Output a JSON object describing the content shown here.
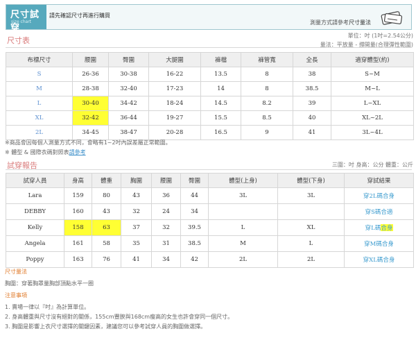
{
  "header": {
    "title": "尺寸試穿",
    "subtitle": "size chart",
    "tagline": "請先確認尺寸再進行購買",
    "right_text": "測量方式請參考",
    "right_strong": "尺寸量法"
  },
  "size_table": {
    "section_title": "尺寸表",
    "unit_note": "單位：吋 (1吋=2.54公分)",
    "method_note": "量法：平放量 - 撐開量(合理彈性範圍)",
    "columns": [
      "布標尺寸",
      "腰圍",
      "臀圍",
      "大腿圍",
      "褲檔",
      "褲管寬",
      "全長",
      "適穿體型(約)"
    ],
    "rows": [
      [
        "S",
        "26-36",
        "30-38",
        "16-22",
        "13.5",
        "8",
        "38",
        "S~M"
      ],
      [
        "M",
        "28-38",
        "32-40",
        "17-23",
        "14",
        "8",
        "38.5",
        "M~L"
      ],
      [
        "L",
        "30-40",
        "34-42",
        "18-24",
        "14.5",
        "8.2",
        "39",
        "L~XL"
      ],
      [
        "XL",
        "32-42",
        "36-44",
        "19-27",
        "15.5",
        "8.5",
        "40",
        "XL~2L"
      ],
      [
        "2L",
        "34-45",
        "38-47",
        "20-28",
        "16.5",
        "9",
        "41",
        "3L~4L"
      ]
    ],
    "note1": "※商品會因每個人測量方式不同，會略有1~2吋內誤差屬正常範圍。",
    "note2": "※ 體型 & 國際衣碼對照表",
    "note2_link": "請參考"
  },
  "fit_report": {
    "section_title": "試穿報告",
    "unit_note": "三圍：吋 身高：公分 體重：公斤",
    "columns": [
      "試穿人員",
      "身高",
      "體重",
      "胸圍",
      "腰圍",
      "臀圍",
      "體型(上身)",
      "體型(下身)",
      "穿試結果"
    ],
    "rows": [
      [
        "Lara",
        "159",
        "80",
        "43",
        "36",
        "44",
        "3L",
        "3L",
        "穿2L碼合身"
      ],
      [
        "DEBBY",
        "160",
        "43",
        "32",
        "24",
        "34",
        "",
        "",
        "穿S碼合適"
      ],
      [
        "Kelly",
        "158",
        "63",
        "37",
        "32",
        "39.5",
        "L",
        "XL",
        "穿L碼合身"
      ],
      [
        "Angela",
        "161",
        "58",
        "35",
        "31",
        "38.5",
        "M",
        "L",
        "穿M碼合身"
      ],
      [
        "Poppy",
        "163",
        "76",
        "41",
        "34",
        "42",
        "2L",
        "2L",
        "穿XL碼合身"
      ]
    ]
  },
  "measure": {
    "title": "尺寸量法",
    "text": "胸圍：穿著胸罩量胸部頂點水平一圈"
  },
  "notes": {
    "title": "注意事項",
    "items": [
      "1. 賣場一律以『吋』為計算單位。",
      "2. 身高體重與尺寸沒有絕對的關係，155cm豐腴與168cm瘦高的女生也許會穿同一個尺寸。",
      "3. 胸圍是影響上衣尺寸選擇的關鍵因素，建議您可以參考試穿人員的胸圍做選擇。"
    ]
  },
  "colors": {
    "accent": "#56a9bd",
    "section": "#d97b7b",
    "size_blue": "#5a8fd0",
    "link": "#3d9ccf",
    "highlight": "#ffff33"
  }
}
